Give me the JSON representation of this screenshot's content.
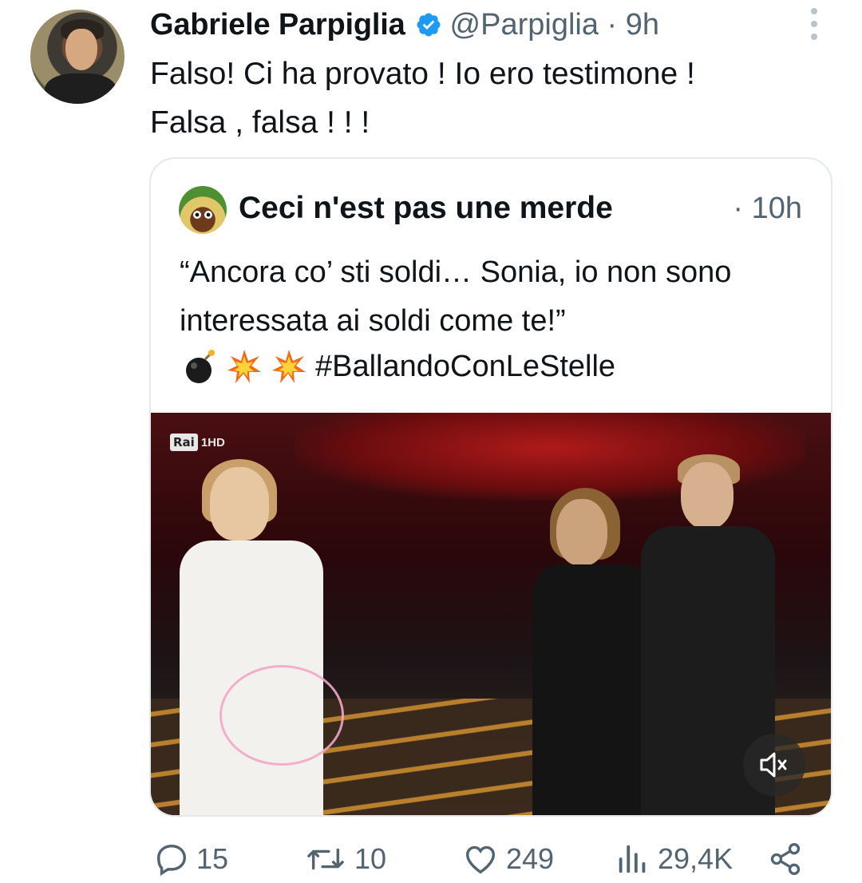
{
  "tweet": {
    "author_name": "Gabriele Parpiglia",
    "handle_time": "@Parpiglia · 9h",
    "text": "Falso! Ci ha provato ! Io ero testimone !\nFalsa , falsa ! ! !",
    "verified": true
  },
  "quoted_tweet": {
    "author_name": "Ceci n'est pas une merde",
    "time": "· 10h",
    "text": "“Ancora co’ sti soldi… Sonia, io non sono interessata ai soldi come te!”",
    "hashtag": "#BallandoConLeStelle",
    "emojis": [
      "bomb-emoji",
      "collision-emoji",
      "collision-emoji"
    ],
    "video": {
      "channel_logo": "Rai",
      "channel_suffix": "1HD",
      "muted": true
    }
  },
  "actions": {
    "replies": "15",
    "retweets": "10",
    "likes": "249",
    "views": "29,4K"
  },
  "colors": {
    "text_primary": "#0f1419",
    "text_secondary": "#536471",
    "verified_blue": "#1d9bf0",
    "border": "#e4e9ed"
  }
}
